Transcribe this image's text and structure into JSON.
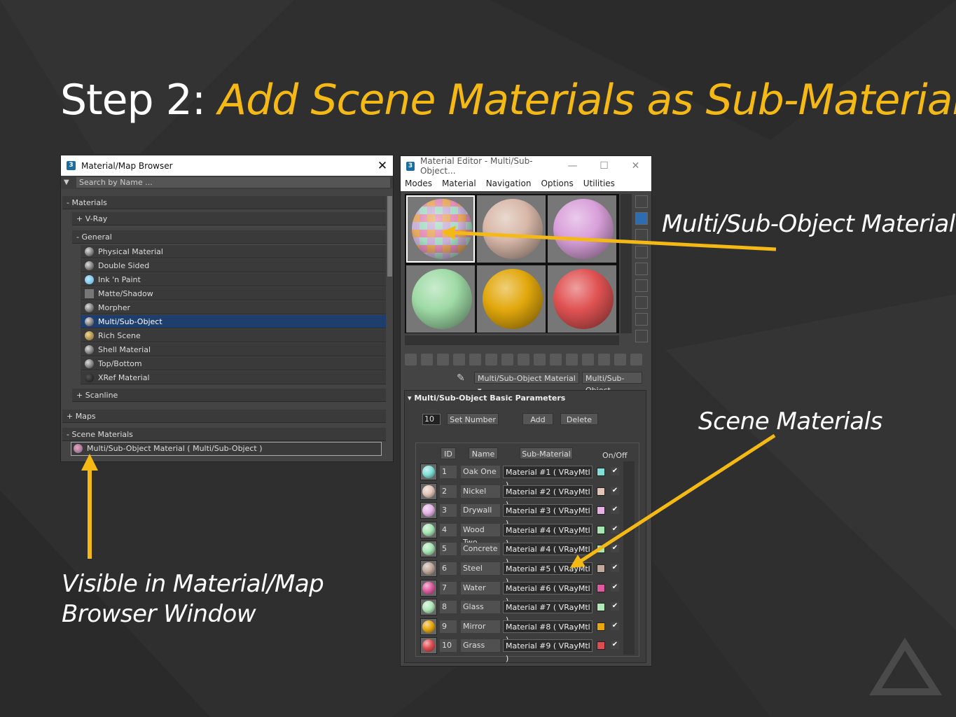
{
  "slide": {
    "title_prefix": "Step 2: ",
    "title_highlight": "Add Scene Materials as Sub-Materials",
    "callout_multi": "Multi/Sub-Object Material",
    "callout_scene": "Scene Materials",
    "callout_browser_1": "Visible in Material/Map",
    "callout_browser_2": "Browser Window",
    "accent_color": "#f5b915"
  },
  "browser": {
    "title": "Material/Map Browser",
    "app_icon": "3",
    "search_placeholder": "Search by Name ...",
    "materials_header": "- Materials",
    "vray": "+ V-Ray",
    "general": "- General",
    "items": [
      "Physical Material",
      "Double Sided",
      "Ink 'n Paint",
      "Matte/Shadow",
      "Morpher",
      "Multi/Sub-Object",
      "Rich Scene",
      "Shell Material",
      "Top/Bottom",
      "XRef Material"
    ],
    "selected": "Multi/Sub-Object",
    "scanline": "+ Scanline",
    "maps": "+ Maps",
    "scene_materials": "- Scene Materials",
    "scene_item": "Multi/Sub-Object Material  ( Multi/Sub-Object )"
  },
  "editor": {
    "title": "Material Editor - Multi/Sub-Object...",
    "menu": [
      "Modes",
      "Material",
      "Navigation",
      "Options",
      "Utilities"
    ],
    "material_name": "Multi/Sub-Object Material",
    "material_type": "Multi/Sub-Object",
    "rollout_title": "Multi/Sub-Object Basic Parameters",
    "count": "10",
    "set_number": "Set Number",
    "add": "Add",
    "delete": "Delete",
    "col_id": "ID",
    "col_name": "Name",
    "col_sub": "Sub-Material",
    "col_onoff": "On/Off",
    "slot_colors": [
      "multi",
      "#d8b8a8",
      "#d9a0da",
      "#9fdba6",
      "#e2a80c",
      "#e05252"
    ],
    "rows": [
      {
        "id": "1",
        "name": "Oak One",
        "sub": "Material #1  ( VRayMtl )",
        "color": "#7fe0d9"
      },
      {
        "id": "2",
        "name": "Nickel",
        "sub": "Material #2  ( VRayMtl )",
        "color": "#e3c5b7"
      },
      {
        "id": "3",
        "name": "Drywall",
        "sub": "Material #3  ( VRayMtl )",
        "color": "#e6b2e6"
      },
      {
        "id": "4",
        "name": "Wood Two",
        "sub": "Material #4  ( VRayMtl )",
        "color": "#a6e6b3"
      },
      {
        "id": "5",
        "name": "Concrete",
        "sub": "Material #4  ( VRayMtl )",
        "color": "#a6e6b3"
      },
      {
        "id": "6",
        "name": "Steel",
        "sub": "Material #5  ( VRayMtl )",
        "color": "#c0a89a"
      },
      {
        "id": "7",
        "name": "Water",
        "sub": "Material #6  ( VRayMtl )",
        "color": "#e05aa0"
      },
      {
        "id": "8",
        "name": "Glass",
        "sub": "Material #7  ( VRayMtl )",
        "color": "#b0e8b8"
      },
      {
        "id": "9",
        "name": "Mirror",
        "sub": "Material #8  ( VRayMtl )",
        "color": "#e8a80c"
      },
      {
        "id": "10",
        "name": "Grass",
        "sub": "Material #9  ( VRayMtl )",
        "color": "#e04a50"
      }
    ]
  }
}
